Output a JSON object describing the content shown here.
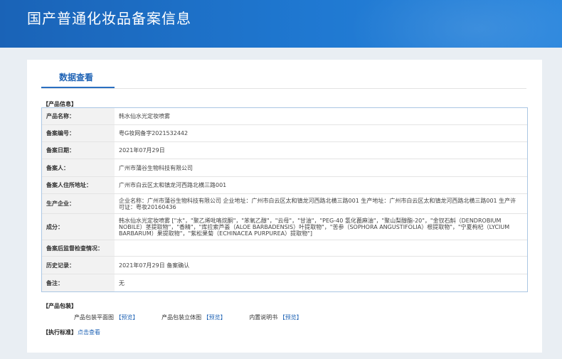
{
  "header": {
    "title": "国产普通化妆品备案信息"
  },
  "tab": {
    "label": "数据查看"
  },
  "product_section": {
    "title": "【产品信息】",
    "rows": [
      {
        "label": "产品名称：",
        "value": "韩水仙水光定妆喷雾"
      },
      {
        "label": "备案编号：",
        "value": "粤G妆网备字2021532442"
      },
      {
        "label": "备案日期：",
        "value": "2021年07月29日"
      },
      {
        "label": "备案人：",
        "value": "广州市蒲谷生物科技有限公司"
      },
      {
        "label": "备案人住所地址：",
        "value": "广州市白云区太和镇龙河西路北横三路001"
      },
      {
        "label": "生产企业：",
        "value": "企业名称：广州市蒲谷生物科技有限公司 企业地址：广州市白云区太和镇龙河西路北横三路001 生产地址：广州市白云区太和镇龙河西路北横三路001 生产许可证：粤妆20160436"
      },
      {
        "label": "成分：",
        "value": "韩水仙水光定妆喷雾 [\"水\"，\"聚乙烯吡咯烷酮\"，\"苯氧乙醇\"，\"云母\"，\"甘油\"，\"PEG-40 氢化蓖麻油\"，\"聚山梨醇酯-20\"，\"金钗石斛（DENDROBIUM NOBILE）茎提取物\"，\"香精\"，\"库拉索芦荟（ALOE BARBADENSIS）叶提取物\"，\"苦参（SOPHORA ANGUSTIFOLIA）根提取物\"，\"宁夏枸杞（LYCIUM BARBARUM）果提取物\"，\"紫松果菊（ECHINACEA PURPUREA）提取物\"]"
      },
      {
        "label": "备案后监督检查情况：",
        "value": ""
      },
      {
        "label": "历史记录：",
        "value": "2021年07月29日  备案确认"
      },
      {
        "label": "备注：",
        "value": "无"
      }
    ]
  },
  "package_section": {
    "title": "【产品包装】",
    "items": [
      {
        "label": "产品包装平面图",
        "link": "【预览】"
      },
      {
        "label": "产品包装立体图",
        "link": "【预览】"
      },
      {
        "label": "内置说明书",
        "link": "【预览】"
      }
    ]
  },
  "standard_section": {
    "title": "【执行标准】",
    "link": "点击查看"
  },
  "colors": {
    "banner": "#1f78d1",
    "link": "#1f63b5",
    "table_border": "#aac6e3"
  }
}
